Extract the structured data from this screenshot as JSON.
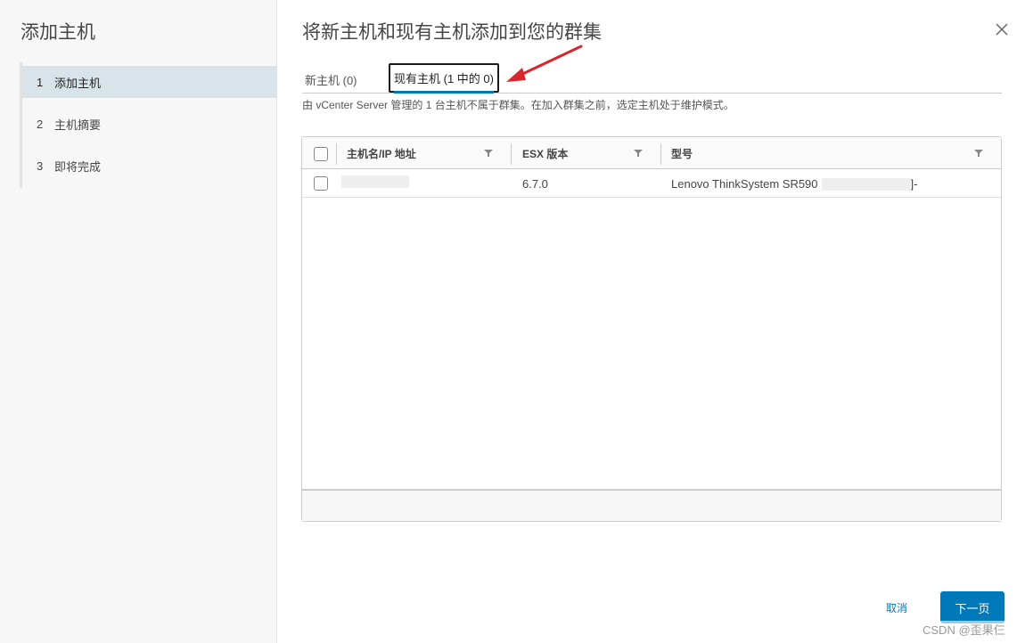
{
  "sidebar": {
    "title": "添加主机",
    "steps": [
      {
        "num": "1",
        "label": "添加主机",
        "active": true
      },
      {
        "num": "2",
        "label": "主机摘要",
        "active": false
      },
      {
        "num": "3",
        "label": "即将完成",
        "active": false
      }
    ]
  },
  "main": {
    "title": "将新主机和现有主机添加到您的群集",
    "tabs": [
      {
        "label": "新主机 (0)",
        "selected": false
      },
      {
        "label": "现有主机 (1 中的 0)",
        "selected": true
      }
    ],
    "info": "由 vCenter Server 管理的 1 台主机不属于群集。在加入群集之前，选定主机处于维护模式。"
  },
  "grid": {
    "columns": [
      "主机名/IP 地址",
      "ESX 版本",
      "型号"
    ],
    "rows": [
      {
        "host": "",
        "esx_version": "6.7.0",
        "model": "Lenovo ThinkSystem SR590",
        "model_suffix": "]-"
      }
    ]
  },
  "footer": {
    "cancel_label": "取消",
    "next_label": "下一页"
  },
  "watermark": "CSDN @歪果仨",
  "colors": {
    "accent": "#0079b8",
    "active_step_bg": "#d9e4ea",
    "annotation_arrow": "#d9262e"
  }
}
